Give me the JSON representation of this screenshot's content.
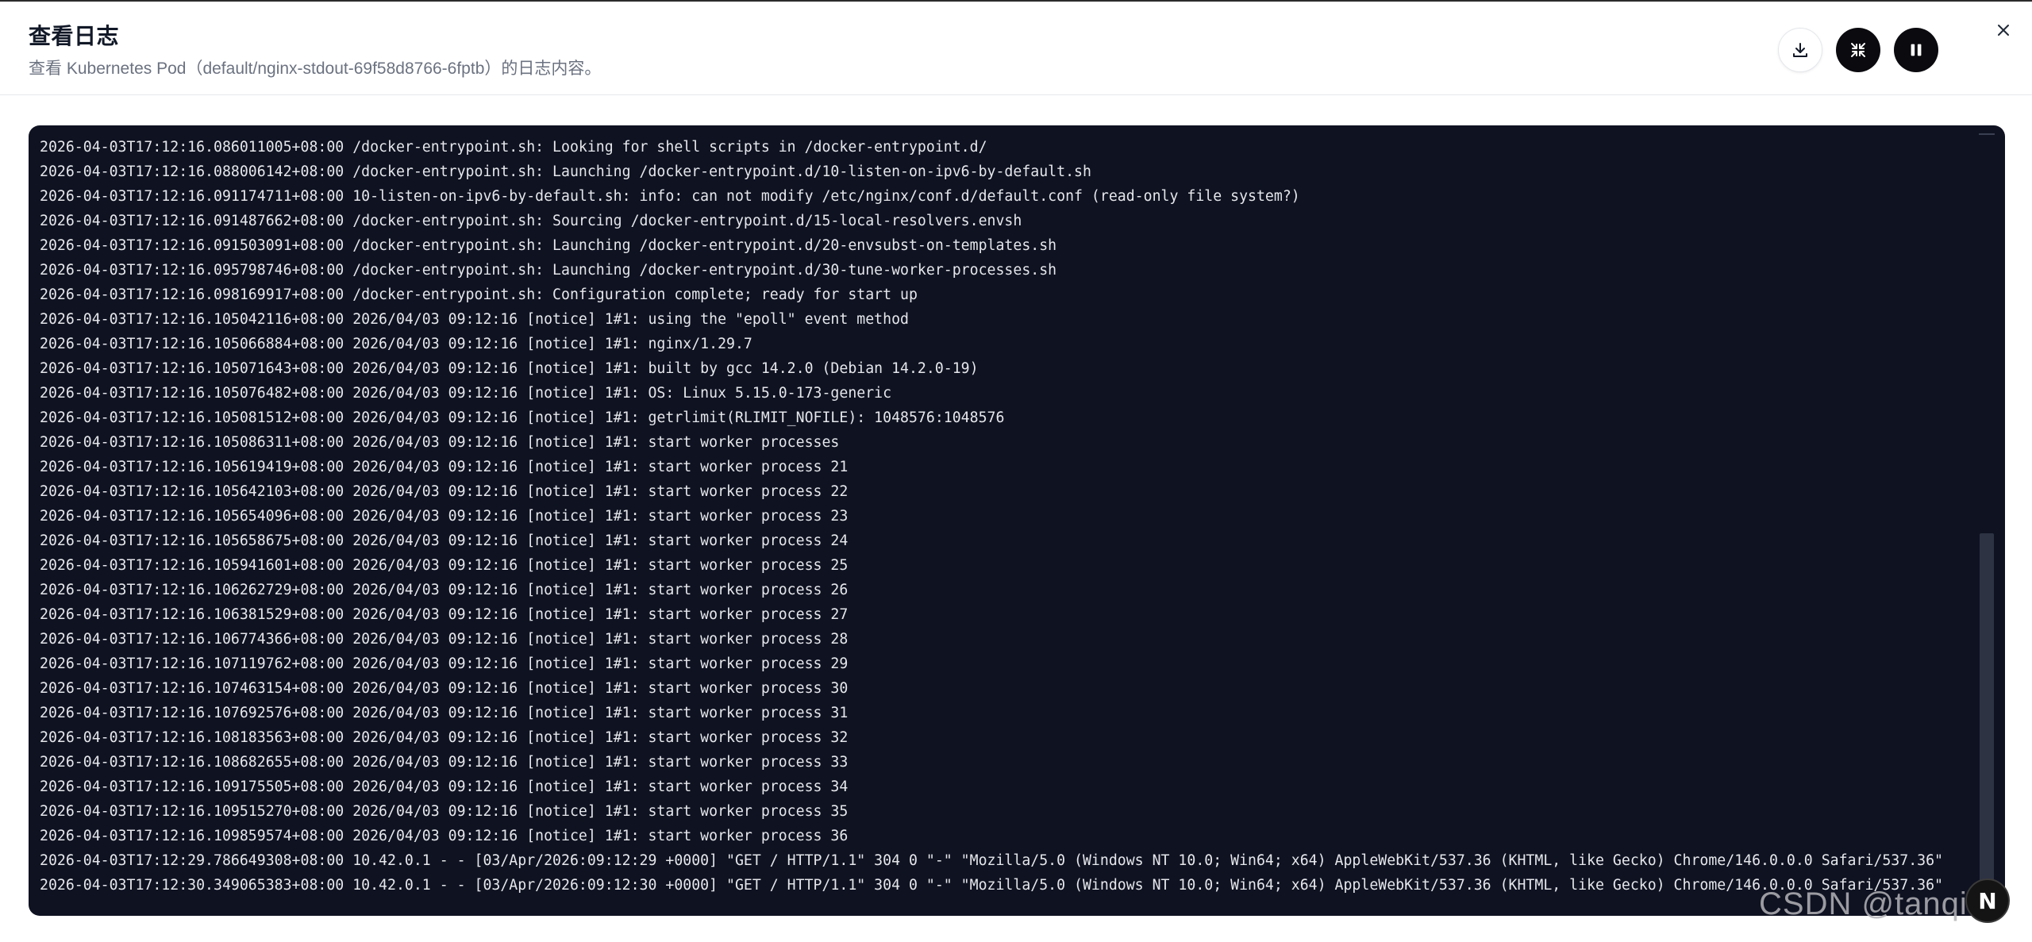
{
  "dialog": {
    "title": "查看日志",
    "subtitle": "查看 Kubernetes Pod（default/nginx-stdout-69f58d8766-6fptb）的日志内容。",
    "actions": {
      "download_icon": "download-icon",
      "collapse_icon": "collapse-icon",
      "pause_icon": "pause-icon",
      "close_icon": "close-icon"
    }
  },
  "log": {
    "lines": [
      "2026-04-03T17:12:16.086011005+08:00 /docker-entrypoint.sh: Looking for shell scripts in /docker-entrypoint.d/",
      "2026-04-03T17:12:16.088006142+08:00 /docker-entrypoint.sh: Launching /docker-entrypoint.d/10-listen-on-ipv6-by-default.sh",
      "2026-04-03T17:12:16.091174711+08:00 10-listen-on-ipv6-by-default.sh: info: can not modify /etc/nginx/conf.d/default.conf (read-only file system?)",
      "2026-04-03T17:12:16.091487662+08:00 /docker-entrypoint.sh: Sourcing /docker-entrypoint.d/15-local-resolvers.envsh",
      "2026-04-03T17:12:16.091503091+08:00 /docker-entrypoint.sh: Launching /docker-entrypoint.d/20-envsubst-on-templates.sh",
      "2026-04-03T17:12:16.095798746+08:00 /docker-entrypoint.sh: Launching /docker-entrypoint.d/30-tune-worker-processes.sh",
      "2026-04-03T17:12:16.098169917+08:00 /docker-entrypoint.sh: Configuration complete; ready for start up",
      "2026-04-03T17:12:16.105042116+08:00 2026/04/03 09:12:16 [notice] 1#1: using the \"epoll\" event method",
      "2026-04-03T17:12:16.105066884+08:00 2026/04/03 09:12:16 [notice] 1#1: nginx/1.29.7",
      "2026-04-03T17:12:16.105071643+08:00 2026/04/03 09:12:16 [notice] 1#1: built by gcc 14.2.0 (Debian 14.2.0-19)",
      "2026-04-03T17:12:16.105076482+08:00 2026/04/03 09:12:16 [notice] 1#1: OS: Linux 5.15.0-173-generic",
      "2026-04-03T17:12:16.105081512+08:00 2026/04/03 09:12:16 [notice] 1#1: getrlimit(RLIMIT_NOFILE): 1048576:1048576",
      "2026-04-03T17:12:16.105086311+08:00 2026/04/03 09:12:16 [notice] 1#1: start worker processes",
      "2026-04-03T17:12:16.105619419+08:00 2026/04/03 09:12:16 [notice] 1#1: start worker process 21",
      "2026-04-03T17:12:16.105642103+08:00 2026/04/03 09:12:16 [notice] 1#1: start worker process 22",
      "2026-04-03T17:12:16.105654096+08:00 2026/04/03 09:12:16 [notice] 1#1: start worker process 23",
      "2026-04-03T17:12:16.105658675+08:00 2026/04/03 09:12:16 [notice] 1#1: start worker process 24",
      "2026-04-03T17:12:16.105941601+08:00 2026/04/03 09:12:16 [notice] 1#1: start worker process 25",
      "2026-04-03T17:12:16.106262729+08:00 2026/04/03 09:12:16 [notice] 1#1: start worker process 26",
      "2026-04-03T17:12:16.106381529+08:00 2026/04/03 09:12:16 [notice] 1#1: start worker process 27",
      "2026-04-03T17:12:16.106774366+08:00 2026/04/03 09:12:16 [notice] 1#1: start worker process 28",
      "2026-04-03T17:12:16.107119762+08:00 2026/04/03 09:12:16 [notice] 1#1: start worker process 29",
      "2026-04-03T17:12:16.107463154+08:00 2026/04/03 09:12:16 [notice] 1#1: start worker process 30",
      "2026-04-03T17:12:16.107692576+08:00 2026/04/03 09:12:16 [notice] 1#1: start worker process 31",
      "2026-04-03T17:12:16.108183563+08:00 2026/04/03 09:12:16 [notice] 1#1: start worker process 32",
      "2026-04-03T17:12:16.108682655+08:00 2026/04/03 09:12:16 [notice] 1#1: start worker process 33",
      "2026-04-03T17:12:16.109175505+08:00 2026/04/03 09:12:16 [notice] 1#1: start worker process 34",
      "2026-04-03T17:12:16.109515270+08:00 2026/04/03 09:12:16 [notice] 1#1: start worker process 35",
      "2026-04-03T17:12:16.109859574+08:00 2026/04/03 09:12:16 [notice] 1#1: start worker process 36",
      "2026-04-03T17:12:29.786649308+08:00 10.42.0.1 - - [03/Apr/2026:09:12:29 +0000] \"GET / HTTP/1.1\" 304 0 \"-\" \"Mozilla/5.0 (Windows NT 10.0; Win64; x64) AppleWebKit/537.36 (KHTML, like Gecko) Chrome/146.0.0.0 Safari/537.36\"",
      "2026-04-03T17:12:30.349065383+08:00 10.42.0.1 - - [03/Apr/2026:09:12:30 +0000] \"GET / HTTP/1.1\" 304 0 \"-\" \"Mozilla/5.0 (Windows NT 10.0; Win64; x64) AppleWebKit/537.36 (KHTML, like Gecko) Chrome/146.0.0.0 Safari/537.36\""
    ]
  },
  "floating": {
    "button_label": "N"
  },
  "watermark": {
    "text": "CSDN @tanqidi"
  },
  "colors": {
    "log_background": "#0f1221",
    "log_text": "#e5e7eb",
    "dark_button": "#0b0b0f"
  }
}
